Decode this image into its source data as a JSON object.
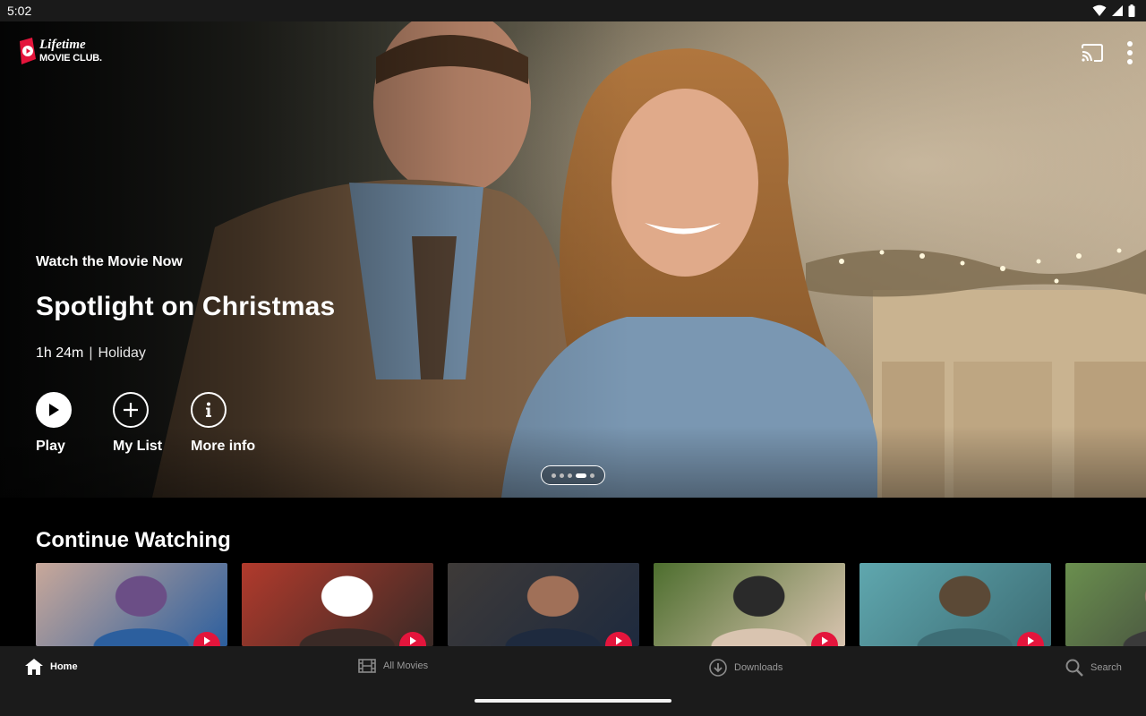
{
  "status_bar": {
    "time": "5:02",
    "icons": [
      "wifi-icon",
      "signal-icon",
      "battery-icon"
    ]
  },
  "app": {
    "logo_line1": "Lifetime",
    "logo_line2": "MOVIE CLUB.",
    "brand_color": "#e4153c"
  },
  "top_actions": [
    "cast-icon",
    "more-vert-icon"
  ],
  "hero": {
    "kicker": "Watch the Movie Now",
    "title": "Spotlight on Christmas",
    "duration": "1h 24m",
    "separator": "|",
    "genre": "Holiday",
    "actions": {
      "play": "Play",
      "my_list": "My List",
      "more_info": "More info"
    },
    "pager": {
      "count": 5,
      "active_index": 3
    }
  },
  "continue_watching": {
    "title": "Continue Watching",
    "tiles": [
      {
        "name": "continue-tile-1",
        "palette": [
          "#c9a89a",
          "#6b4e86",
          "#2c5f9e"
        ]
      },
      {
        "name": "continue-tile-2",
        "palette": [
          "#b13a2c",
          "#ffffff",
          "#3a2a26"
        ]
      },
      {
        "name": "continue-tile-3",
        "palette": [
          "#3e3a38",
          "#a07058",
          "#1e2a3e"
        ]
      },
      {
        "name": "continue-tile-4",
        "palette": [
          "#4d6e2e",
          "#2a2a2a",
          "#d9c4b0"
        ]
      },
      {
        "name": "continue-tile-5",
        "palette": [
          "#5fa7ae",
          "#5b4936",
          "#3d6d75"
        ]
      },
      {
        "name": "continue-tile-6",
        "palette": [
          "#6a8f4e",
          "#9a7a6a",
          "#3a3a3a"
        ]
      }
    ]
  },
  "bottom_nav": {
    "items": [
      {
        "label": "Home",
        "icon": "home-icon",
        "active": true
      },
      {
        "label": "All Movies",
        "icon": "film-icon",
        "active": false
      },
      {
        "label": "Downloads",
        "icon": "download-icon",
        "active": false
      },
      {
        "label": "Search",
        "icon": "search-icon",
        "active": false
      }
    ]
  }
}
